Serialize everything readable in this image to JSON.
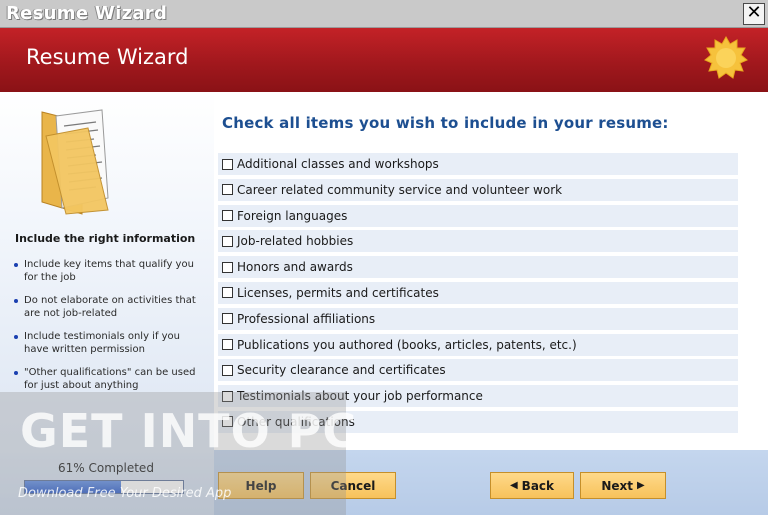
{
  "window": {
    "title": "Resume Wizard",
    "close_glyph": "✕"
  },
  "header": {
    "title": "Resume Wizard",
    "icon": "sun-seal-icon"
  },
  "sidebar": {
    "heading": "Include the right information",
    "tips": [
      "Include key items that qualify you for the job",
      "Do not elaborate on activities that are not job-related",
      "Include testimonials only if you have written permission",
      "\"Other qualifications\" can be used for just about anything"
    ]
  },
  "main": {
    "prompt": "Check all items you wish to include in your resume:",
    "items": [
      "Additional classes and workshops",
      "Career related community service and volunteer work",
      "Foreign languages",
      "Job-related hobbies",
      "Honors and awards",
      "Licenses, permits and certificates",
      "Professional affiliations",
      "Publications you authored (books, articles, patents, etc.)",
      "Security clearance and certificates",
      "Testimonials about your job performance",
      "Other qualifications"
    ]
  },
  "progress": {
    "label": "61% Completed",
    "value": 0.61
  },
  "buttons": {
    "help": "Help",
    "cancel": "Cancel",
    "back": "Back",
    "next": "Next"
  },
  "watermark": {
    "title": "GET INTO PC",
    "subtitle": "Download Free Your Desired App"
  },
  "colors": {
    "header_red": "#a1181d",
    "prompt_blue": "#1d4f91",
    "button_gold": "#f7c25b"
  }
}
